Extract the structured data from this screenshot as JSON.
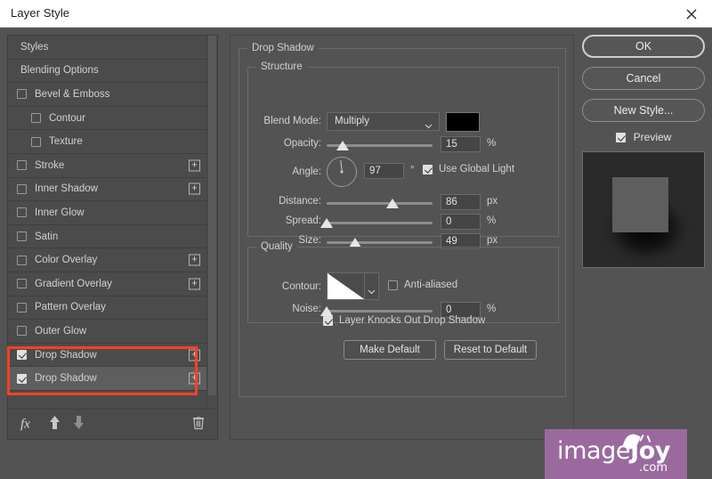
{
  "window": {
    "title": "Layer Style",
    "close_icon": "close-icon"
  },
  "styles_panel": {
    "items": [
      {
        "label": "Styles",
        "type": "header",
        "checkbox": null,
        "plus": false
      },
      {
        "label": "Blending Options",
        "type": "header",
        "checkbox": null,
        "plus": false
      },
      {
        "label": "Bevel & Emboss",
        "type": "effect",
        "checkbox": false,
        "plus": false
      },
      {
        "label": "Contour",
        "type": "sub",
        "checkbox": false,
        "plus": false
      },
      {
        "label": "Texture",
        "type": "sub",
        "checkbox": false,
        "plus": false
      },
      {
        "label": "Stroke",
        "type": "effect",
        "checkbox": false,
        "plus": true
      },
      {
        "label": "Inner Shadow",
        "type": "effect",
        "checkbox": false,
        "plus": true
      },
      {
        "label": "Inner Glow",
        "type": "effect",
        "checkbox": false,
        "plus": false
      },
      {
        "label": "Satin",
        "type": "effect",
        "checkbox": false,
        "plus": false
      },
      {
        "label": "Color Overlay",
        "type": "effect",
        "checkbox": false,
        "plus": true
      },
      {
        "label": "Gradient Overlay",
        "type": "effect",
        "checkbox": false,
        "plus": true
      },
      {
        "label": "Pattern Overlay",
        "type": "effect",
        "checkbox": false,
        "plus": false
      },
      {
        "label": "Outer Glow",
        "type": "effect",
        "checkbox": false,
        "plus": false
      },
      {
        "label": "Drop Shadow",
        "type": "effect",
        "checkbox": true,
        "plus": true,
        "selected": false
      },
      {
        "label": "Drop Shadow",
        "type": "effect",
        "checkbox": true,
        "plus": true,
        "selected": true
      }
    ],
    "toolbar": {
      "fx_label": "fx",
      "up_icon": "arrow-up-icon",
      "down_icon": "arrow-down-icon",
      "delete_icon": "trash-icon"
    }
  },
  "annotation": {
    "color": "#f8402a",
    "shape": "rectangle"
  },
  "settings": {
    "effect_title": "Drop Shadow",
    "structure": {
      "legend": "Structure",
      "blend_mode_label": "Blend Mode:",
      "blend_mode_value": "Multiply",
      "shadow_color": "#000000",
      "opacity_label": "Opacity:",
      "opacity_value": "15",
      "opacity_unit": "%",
      "opacity_pct": 15,
      "angle_label": "Angle:",
      "angle_value": "97",
      "angle_unit": "°",
      "use_global_light_label": "Use Global Light",
      "use_global_light_checked": true,
      "distance_label": "Distance:",
      "distance_value": "86",
      "distance_unit": "px",
      "distance_pct": 62,
      "spread_label": "Spread:",
      "spread_value": "0",
      "spread_unit": "%",
      "spread_pct": 0,
      "size_label": "Size:",
      "size_value": "49",
      "size_unit": "px",
      "size_pct": 27
    },
    "quality": {
      "legend": "Quality",
      "contour_label": "Contour:",
      "anti_aliased_label": "Anti-aliased",
      "anti_aliased_checked": false,
      "noise_label": "Noise:",
      "noise_value": "0",
      "noise_unit": "%",
      "noise_pct": 0
    },
    "knocks_out_label": "Layer Knocks Out Drop Shadow",
    "knocks_out_checked": true,
    "make_default_label": "Make Default",
    "reset_default_label": "Reset to Default"
  },
  "buttons": {
    "ok": "OK",
    "cancel": "Cancel",
    "new_style": "New Style...",
    "preview_label": "Preview",
    "preview_checked": true
  },
  "watermark": {
    "text_light": "image",
    "text_bold": "Joy",
    "domain": ".com",
    "background": "#9a6a9e"
  }
}
